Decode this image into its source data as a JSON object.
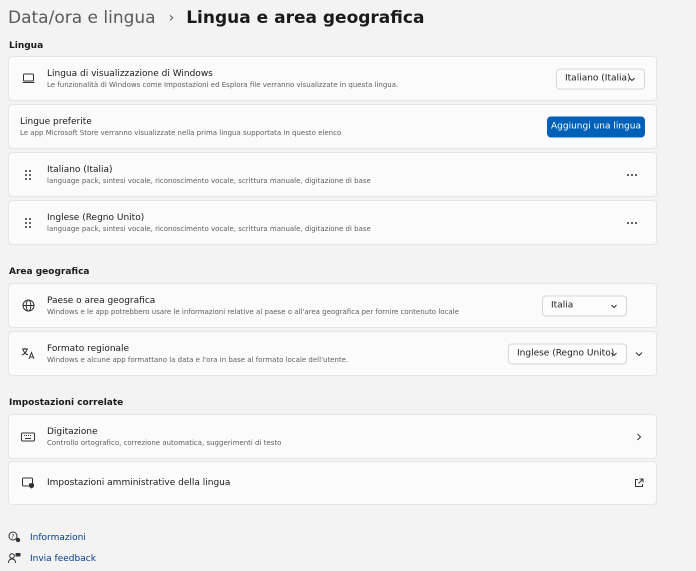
{
  "breadcrumb": {
    "parent": "Data/ora e lingua",
    "separator": "›",
    "current": "Lingua e area geografica"
  },
  "sections": {
    "lingua": "Lingua",
    "area": "Area geografica",
    "correlate": "Impostazioni correlate"
  },
  "display_language": {
    "title": "Lingua di visualizzazione di Windows",
    "desc": "Le funzionalità di Windows come Impostazioni ed Esplora file verranno visualizzate in questa lingua.",
    "selected": "Italiano (Italia)"
  },
  "preferred_languages": {
    "title": "Lingue preferite",
    "desc": "Le app Microsoft Store verranno visualizzate nella prima lingua supportata in questo elenco",
    "add_button": "Aggiungi una lingua"
  },
  "languages": [
    {
      "name": "Italiano (Italia)",
      "features": "language pack, sintesi vocale, riconoscimento vocale, scrittura manuale, digitazione di base"
    },
    {
      "name": "Inglese (Regno Unito)",
      "features": "language pack, sintesi vocale, riconoscimento vocale, scrittura manuale, digitazione di base"
    }
  ],
  "country": {
    "title": "Paese o area geografica",
    "desc": "Windows e le app potrebbero usare le informazioni relative al paese o all'area geografica per fornire contenuto locale",
    "selected": "Italia"
  },
  "regional_format": {
    "title": "Formato regionale",
    "desc": "Windows e alcune app formattano la data e l'ora in base al formato locale dell'utente.",
    "selected": "Inglese (Regno Unito)"
  },
  "typing": {
    "title": "Digitazione",
    "desc": "Controllo ortografico, correzione automatica, suggerimenti di testo"
  },
  "admin_settings": {
    "title": "Impostazioni amministrative della lingua"
  },
  "footer": {
    "info": "Informazioni",
    "feedback": "Invia feedback"
  },
  "colors": {
    "accent": "#0060b8",
    "link": "#003e8a",
    "background": "#f3f3f3",
    "card": "#fbfbfb"
  },
  "icons": {
    "display_language": "laptop-icon",
    "drag_handle": "grip-dots-icon",
    "more": "more-horizontal-icon",
    "country": "globe-icon",
    "regional_format": "language-format-icon",
    "typing": "keyboard-icon",
    "admin": "shield-window-icon",
    "external": "open-external-icon",
    "info": "help-chat-icon",
    "feedback": "feedback-person-icon"
  }
}
